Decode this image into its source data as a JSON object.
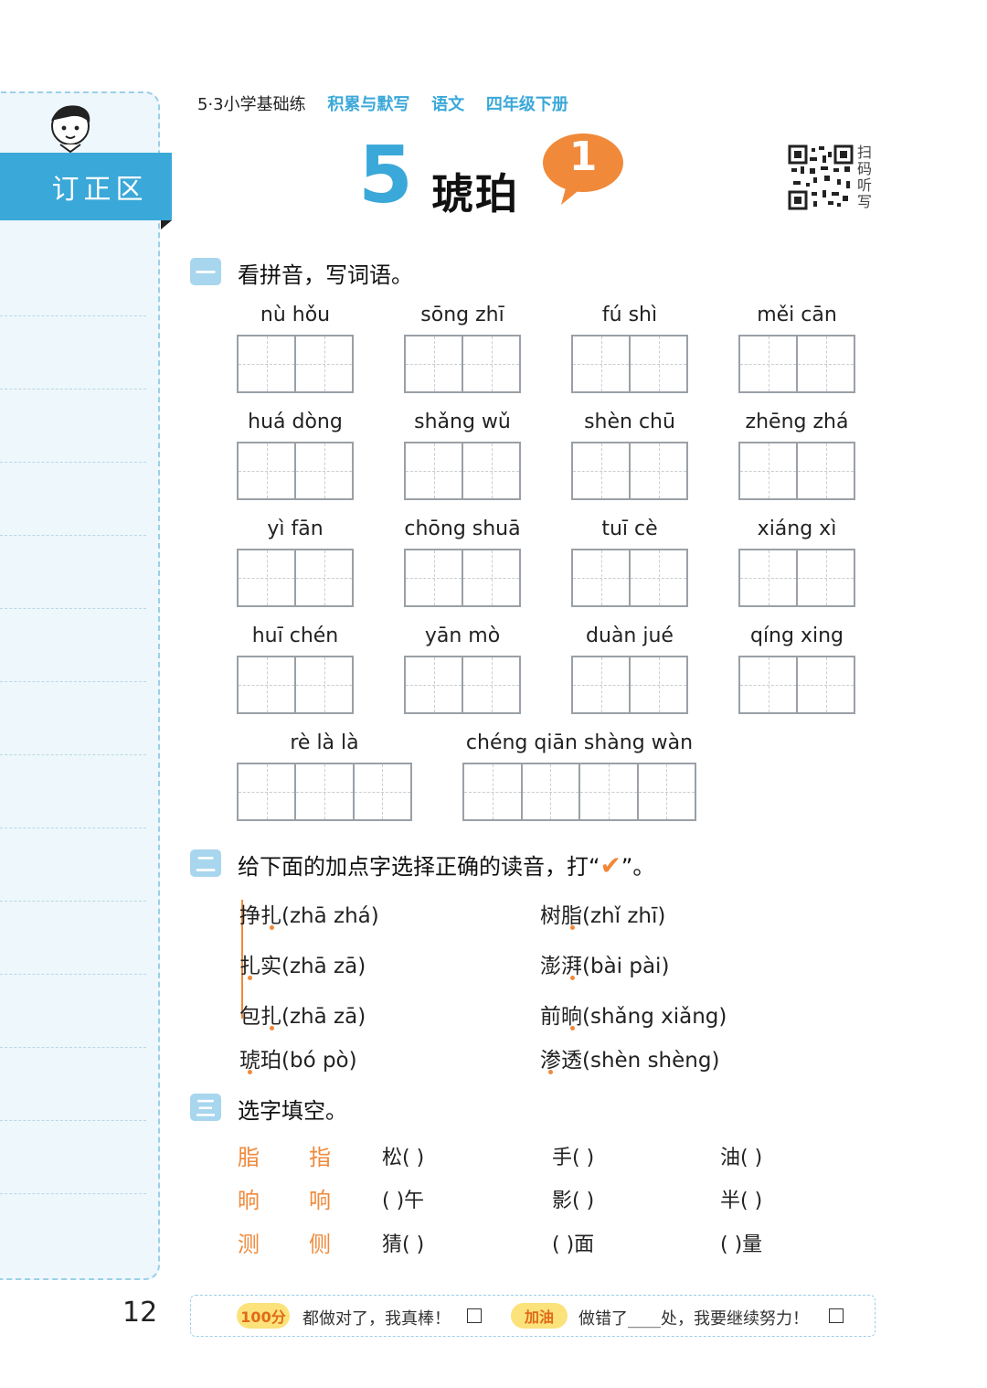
{
  "header": {
    "series": "5·3小学基础练",
    "book": "积累与默写",
    "subject": "语文",
    "grade": "四年级下册"
  },
  "sidebar": {
    "tab_label": "订正区"
  },
  "lesson": {
    "number": "5",
    "title": "琥珀",
    "badge": "1",
    "qr_label": "扫码听写"
  },
  "part1": {
    "icon": "一",
    "title": "看拼音，写词语。",
    "rows": [
      [
        {
          "pinyin": "nù   hǒu",
          "cells": 2
        },
        {
          "pinyin": "sōng   zhī",
          "cells": 2
        },
        {
          "pinyin": "fú   shì",
          "cells": 2
        },
        {
          "pinyin": "měi   cān",
          "cells": 2
        }
      ],
      [
        {
          "pinyin": "huá  dòng",
          "cells": 2
        },
        {
          "pinyin": "shǎng  wǔ",
          "cells": 2
        },
        {
          "pinyin": "shèn  chū",
          "cells": 2
        },
        {
          "pinyin": "zhēng  zhá",
          "cells": 2
        }
      ],
      [
        {
          "pinyin": "yì   fān",
          "cells": 2
        },
        {
          "pinyin": "chōng shuā",
          "cells": 2
        },
        {
          "pinyin": "tuī   cè",
          "cells": 2
        },
        {
          "pinyin": "xiáng   xì",
          "cells": 2
        }
      ],
      [
        {
          "pinyin": "huī  chén",
          "cells": 2
        },
        {
          "pinyin": "yān   mò",
          "cells": 2
        },
        {
          "pinyin": "duàn  jué",
          "cells": 2
        },
        {
          "pinyin": "qíng  xing",
          "cells": 2
        }
      ],
      [
        {
          "pinyin": "rè     là     là",
          "cells": 3
        },
        {
          "pinyin": "chéng qiān shàng wàn",
          "cells": 4
        }
      ]
    ]
  },
  "part2": {
    "icon": "二",
    "title_prefix": "给下面的加点字选择正确的读音，打“",
    "title_suffix": "”。",
    "check_mark": "✔",
    "items_left": [
      {
        "word": "挣扎",
        "options": "(zhā   zhá)"
      },
      {
        "word": "扎实",
        "options": "(zhā   zā)"
      },
      {
        "word": "包扎",
        "options": "(zhā   zā)"
      },
      {
        "word": "琥珀",
        "options": "(bó   pò)"
      }
    ],
    "items_right": [
      {
        "word": "树脂",
        "options": "(zhǐ   zhī)"
      },
      {
        "word": "澎湃",
        "options": "(bài   pài)"
      },
      {
        "word": "前晌",
        "options": "(shǎng   xiǎng)"
      },
      {
        "word": "渗透",
        "options": "(shèn   shèng)"
      }
    ]
  },
  "part3": {
    "icon": "三",
    "title": "选字填空。",
    "rows": [
      {
        "opt1": "脂",
        "opt2": "指",
        "blanks": [
          "松(      )",
          "手(      )",
          "油(      )"
        ]
      },
      {
        "opt1": "晌",
        "opt2": "响",
        "blanks": [
          "(      )午",
          "影(      )",
          "半(      )"
        ]
      },
      {
        "opt1": "测",
        "opt2": "侧",
        "blanks": [
          "猜(      )",
          "(      )面",
          "(      )量"
        ]
      }
    ]
  },
  "footer": {
    "page_number": "12",
    "badge1": "100分",
    "text1": "都做对了，我真棒！",
    "badge2": "加油",
    "text2": "做错了____处，我要继续努力！"
  },
  "colors": {
    "accent": "#3aa8d8",
    "orange": "#f0893a",
    "grid": "#9aa0a6"
  }
}
